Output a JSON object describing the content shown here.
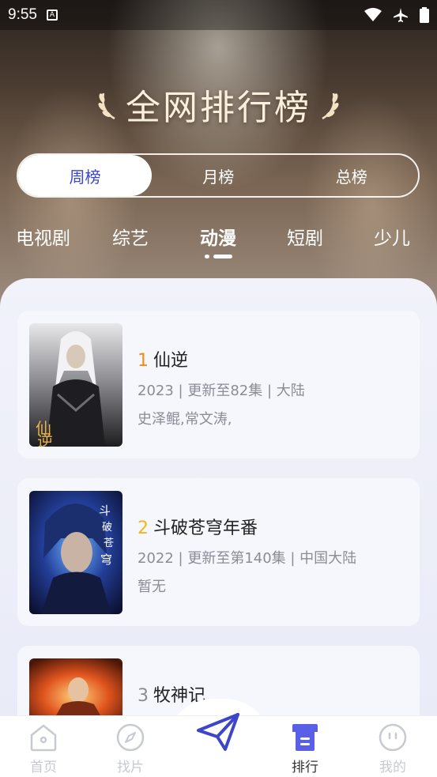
{
  "status_bar": {
    "time": "9:55"
  },
  "header": {
    "title": "全网排行榜"
  },
  "segments": [
    {
      "label": "周榜",
      "active": true
    },
    {
      "label": "月榜",
      "active": false
    },
    {
      "label": "总榜",
      "active": false
    }
  ],
  "categories": [
    {
      "label": "电视剧",
      "active": false
    },
    {
      "label": "综艺",
      "active": false
    },
    {
      "label": "动漫",
      "active": true
    },
    {
      "label": "短剧",
      "active": false
    },
    {
      "label": "少儿",
      "active": false
    }
  ],
  "list": [
    {
      "rank": "1",
      "rank_color": "#f08a1d",
      "title": "仙逆",
      "meta": "2023 | 更新至82集 | 大陆",
      "cast": "史泽鲲,常文涛,"
    },
    {
      "rank": "2",
      "rank_color": "#f5b51b",
      "title": "斗破苍穹年番",
      "meta": "2022 | 更新至第140集 | 中国大陆",
      "cast": "暂无"
    },
    {
      "rank": "3",
      "rank_color": "#8a8c96",
      "title": "牧神记",
      "meta": "",
      "cast": ""
    }
  ],
  "tabbar": [
    {
      "label": "首页",
      "icon": "home-icon",
      "active": false
    },
    {
      "label": "找片",
      "icon": "compass-icon",
      "active": false
    },
    {
      "label": "",
      "icon": "paper-plane-icon",
      "active": false
    },
    {
      "label": "排行",
      "icon": "ranking-icon",
      "active": true
    },
    {
      "label": "我的",
      "icon": "profile-icon",
      "active": false
    }
  ],
  "colors": {
    "accent": "#3d46c8",
    "rank1": "#f08a1d",
    "rank2": "#f5b51b",
    "inactive_tab": "#c8cad2"
  }
}
